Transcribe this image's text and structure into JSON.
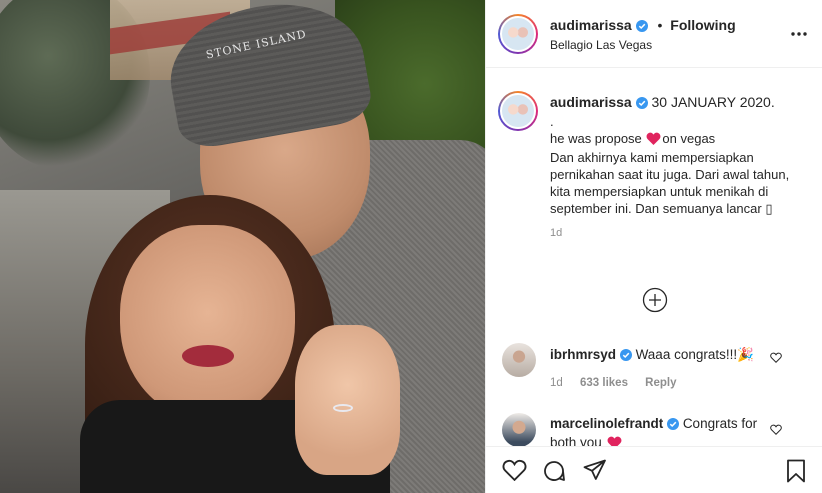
{
  "post": {
    "username": "audimarissa",
    "separator": "•",
    "follow_status": "Following",
    "location": "Bellagio Las Vegas",
    "photo_text": "STONE ISLAND"
  },
  "caption": {
    "username": "audimarissa",
    "date": "30 JANUARY 2020.",
    "dot_line": ".",
    "line1_a": "he was propose ",
    "line1_b": "on vegas",
    "body": "Dan akhirnya kami mempersiapkan pernikahan saat itu juga. Dari awal tahun, kita mempersiapkan untuk menikah di september ini. Dan semuanya lancar ",
    "trailing_glyph": "▯",
    "timestamp": "1d"
  },
  "comments": [
    {
      "username": "ibrhmrsyd",
      "text": "Waaa congrats!!!",
      "emoji": "🎉",
      "time": "1d",
      "likes": "633 likes",
      "reply": "Reply"
    },
    {
      "username": "marcelinolefrandt",
      "text": "Congrats for both you "
    }
  ],
  "colors": {
    "verified_blue": "#3897f0",
    "heart_red": "#ed4956",
    "muted_text": "#8e8e8e",
    "divider": "#efefef"
  },
  "icons": [
    "verified-badge-icon",
    "more-options-icon",
    "load-more-comments-icon",
    "like-comment-icon",
    "heart-icon",
    "comment-icon",
    "share-icon",
    "save-icon"
  ]
}
